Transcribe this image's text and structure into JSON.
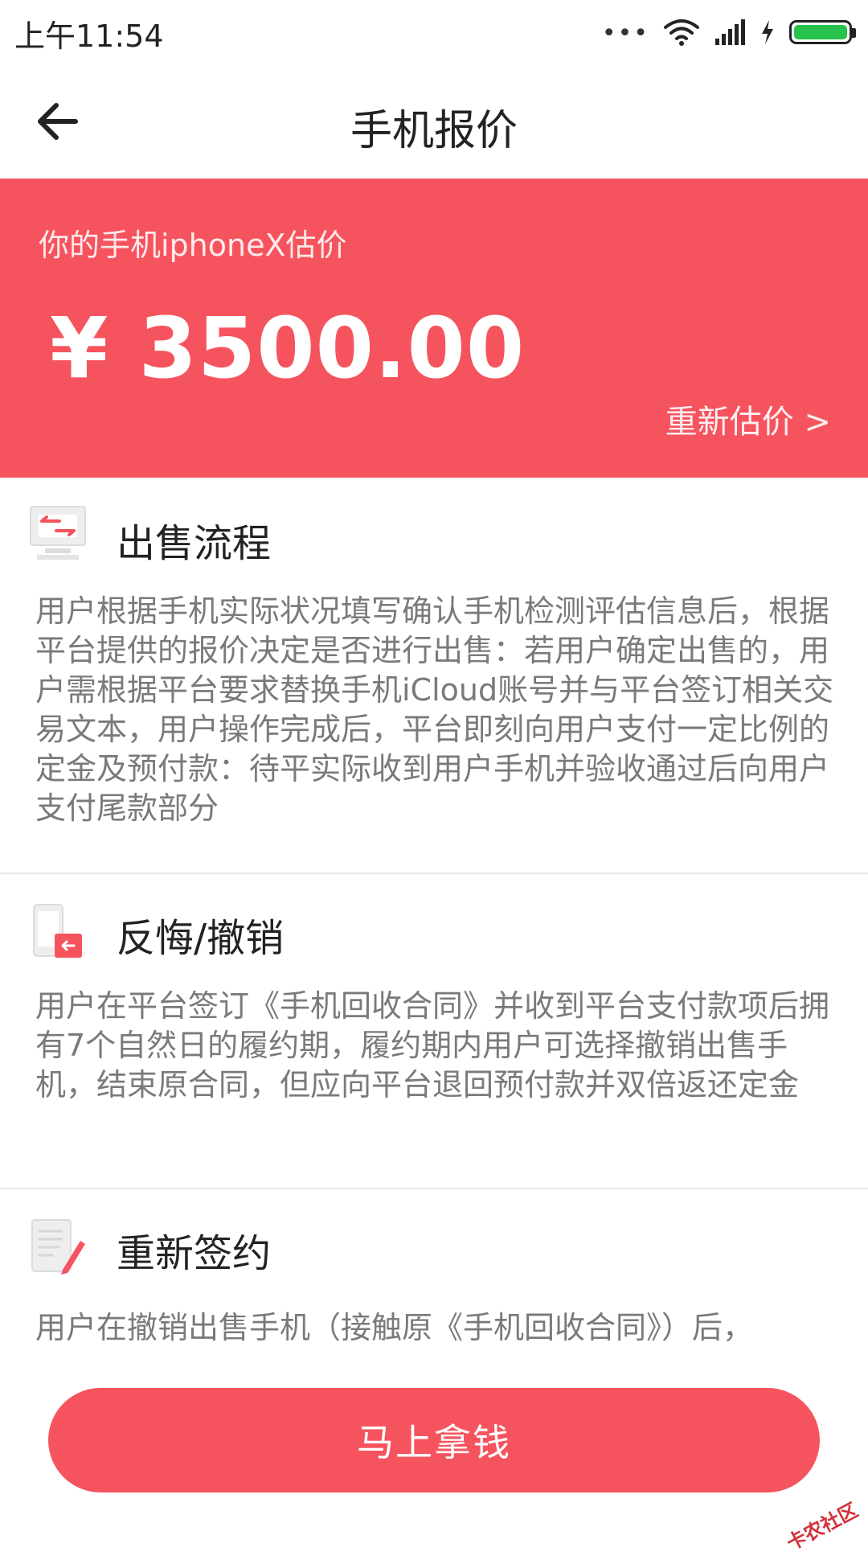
{
  "status_bar": {
    "time": "上午11:54",
    "dots": "•••"
  },
  "nav": {
    "title": "手机报价"
  },
  "hero": {
    "caption": "你的手机iphoneX估价",
    "price": "¥ 3500.00",
    "reestimate": "重新估价 >"
  },
  "sections": [
    {
      "title": "出售流程",
      "icon": "monitor-transfer-icon",
      "text": "用户根据手机实际状况填写确认手机检测评估信息后，根据平台提供的报价决定是否进行出售：若用户确定出售的，用户需根据平台要求替换手机iCloud账号并与平台签订相关交易文本，用户操作完成后，平台即刻向用户支付一定比例的定金及预付款：待平实际收到用户手机并验收通过后向用户支付尾款部分"
    },
    {
      "title": "反悔/撤销",
      "icon": "phone-return-icon",
      "text": "用户在平台签订《手机回收合同》并收到平台支付款项后拥有7个自然日的履约期，履约期内用户可选择撤销出售手机，结束原合同，但应向平台退回预付款并双倍返还定金"
    },
    {
      "title": "重新签约",
      "icon": "document-pen-icon",
      "text": "用户在撤销出售手机（接触原《手机回收合同》）后，"
    }
  ],
  "cta": {
    "label": "马上拿钱"
  },
  "watermark": "卡农社区",
  "colors": {
    "accent": "#f5545f",
    "battery": "#27c24c"
  }
}
